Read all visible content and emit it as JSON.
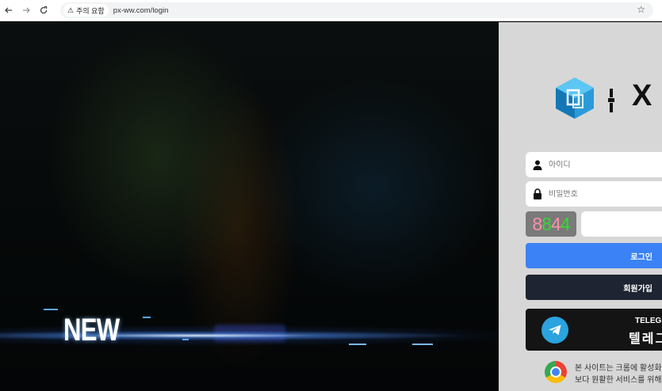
{
  "browser": {
    "url": "px-ww.com/login",
    "security_chip": "주의 요함",
    "back_icon": "arrow-left-icon",
    "forward_icon": "arrow-right-icon",
    "reload_icon": "reload-icon",
    "bookmark_icon": "star-icon"
  },
  "hero": {
    "badge_text": "NEW"
  },
  "login": {
    "logo_text": "X",
    "username_placeholder": "아이디",
    "password_placeholder": "비밀번호",
    "captcha_code": [
      "8",
      "8",
      "4",
      "4"
    ],
    "captcha_colors": [
      "#ff8fa8",
      "#37d437",
      "#ff8fa8",
      "#2ce02c"
    ],
    "login_button": "로그인",
    "join_button": "회원가입",
    "telegram_title": "TELEG",
    "telegram_subtitle": "텔레그",
    "notice_line1": "본 사이트는 크롬에 활성화",
    "notice_line2": "보다 원활한 서비스를 위해"
  },
  "colors": {
    "accent_blue": "#3b82f6",
    "dark_button": "#1e2431",
    "telegram_blue": "#2aa3df",
    "panel_bg": "#d7d7d7"
  }
}
